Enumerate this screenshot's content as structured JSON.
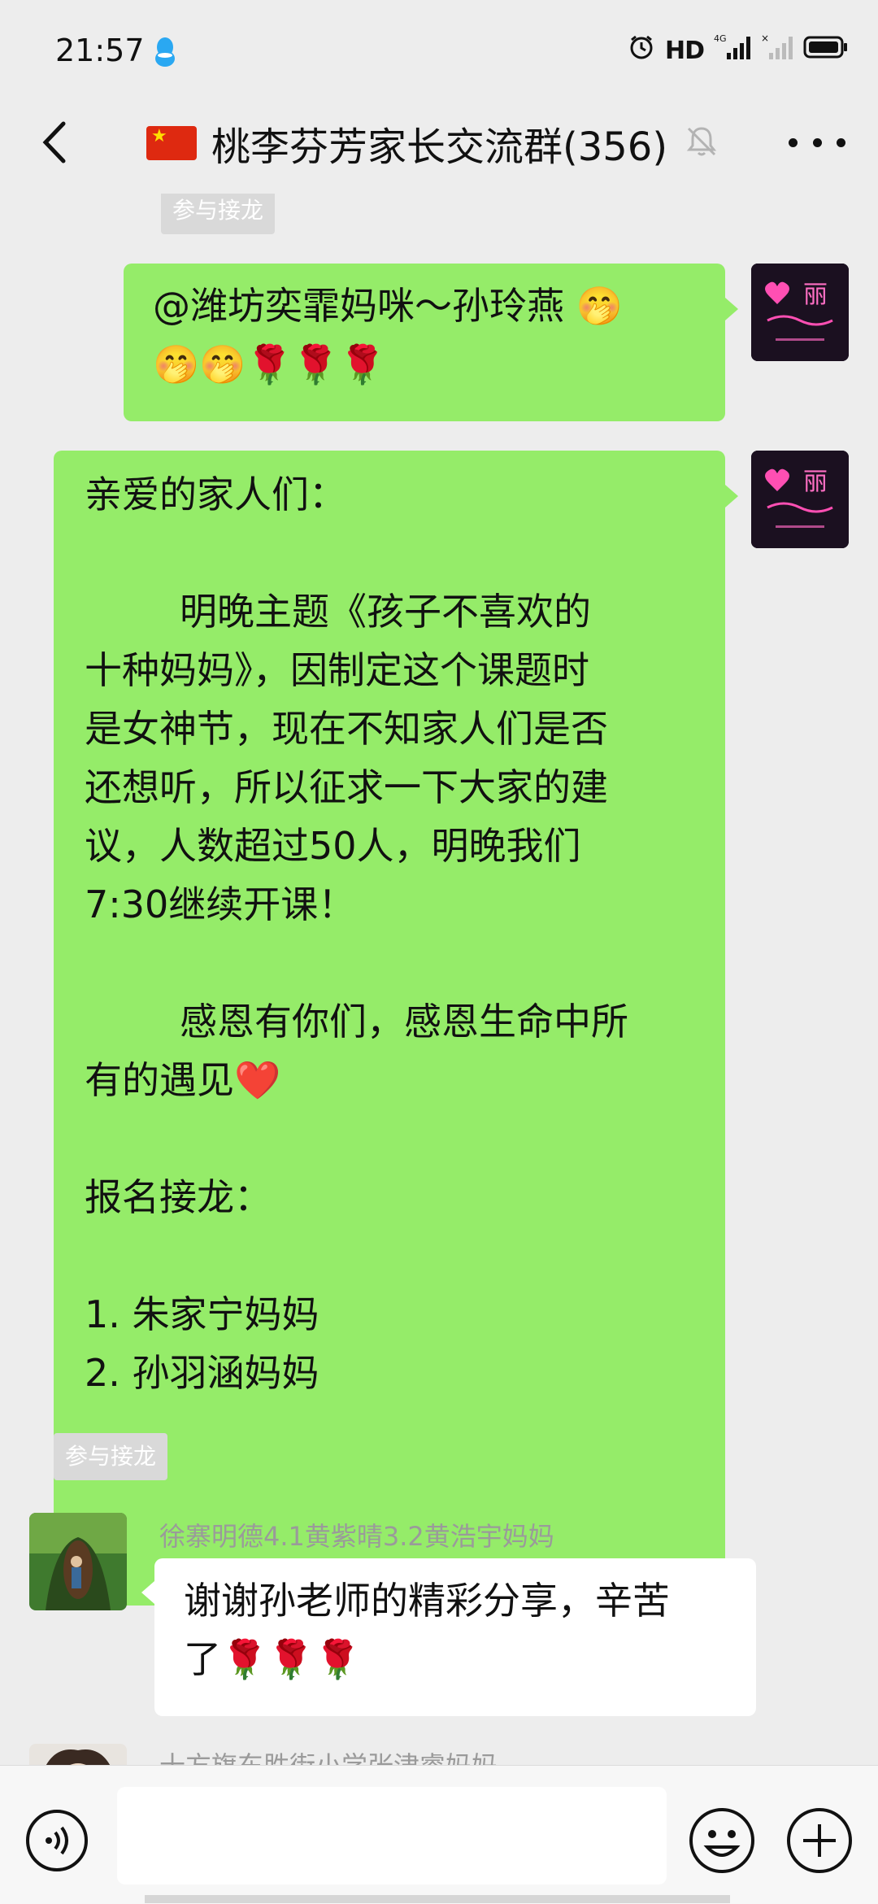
{
  "status_bar": {
    "time": "21:57",
    "network": "HD",
    "signal_label": "4G"
  },
  "header": {
    "title": "桃李芬芳家长交流群(356)"
  },
  "messages": {
    "top_tag": "参与接龙",
    "msg1": {
      "text": "@潍坊奕霏妈咪～孙玲燕 🤭",
      "emojis": "🤭🤭🌹🌹🌹"
    },
    "msg2": {
      "text": "亲爱的家人们：\n\n        明晚主题《孩子不喜欢的\n十种妈妈》，因制定这个课题时\n是女神节，现在不知家人们是否\n还想听，所以征求一下大家的建\n议，人数超过50人，明晚我们\n7:30继续开课！\n\n        感恩有你们，感恩生命中所\n有的遇见❤️\n\n报名接龙：\n\n1. 朱家宁妈妈\n2. 孙羽涵妈妈",
      "tag": "参与接龙"
    },
    "msg3": {
      "sender": "徐寨明德4.1黄紫晴3.2黄浩宇妈妈",
      "text": "谢谢孙老师的精彩分享，辛苦\n了🌹🌹🌹"
    },
    "msg4": {
      "sender": "十方旗东胜街小学张津睿妈妈"
    }
  },
  "input": {
    "placeholder": ""
  },
  "colors": {
    "background": "#ededed",
    "self_bubble": "#95ec69",
    "other_bubble": "#ffffff",
    "tag_bg": "#d9d9d9"
  }
}
